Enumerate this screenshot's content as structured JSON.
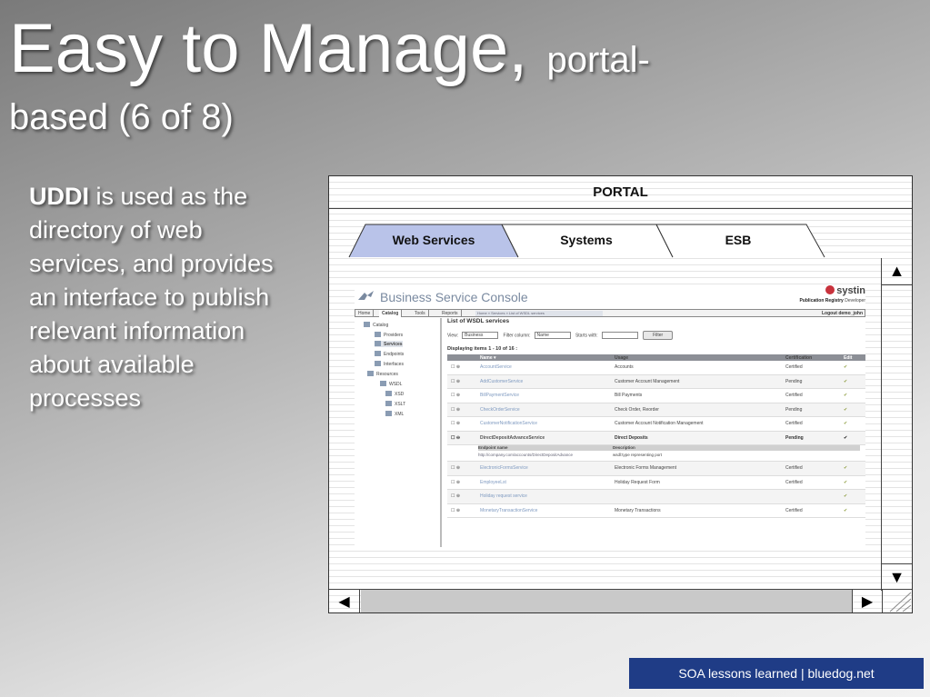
{
  "slide": {
    "title_main": "Easy to Manage,",
    "title_small": "portal-",
    "title_line2": "based (6 of 8)",
    "bullet_bold": "UDDI",
    "bullet_text": " is used as the directory of web services, and provides an interface to publish relevant information about available processes",
    "footer": "SOA lessons learned | bluedog.net"
  },
  "portal": {
    "title": "PORTAL",
    "tabs": [
      {
        "label": "Web Services",
        "active": true
      },
      {
        "label": "Systems",
        "active": false
      },
      {
        "label": "ESB",
        "active": false
      }
    ],
    "scroll": {
      "up_icon": "▲",
      "down_icon": "▼",
      "left_icon": "◀",
      "right_icon": "▶"
    }
  },
  "console": {
    "title": "Business Service Console",
    "brand": "systin",
    "registry_label": "Publication Registry",
    "registry_user": "Developer",
    "nav_tabs": [
      "Home",
      "Catalog",
      "Tools",
      "Reports"
    ],
    "breadcrumb": "Home » Services » List of WSDL services",
    "logout": "Logout demo_john",
    "tree": [
      "Catalog",
      "Providers",
      "Services",
      "Endpoints",
      "Interfaces",
      "Resources",
      "WSDL",
      "XSD",
      "XSLT",
      "XML"
    ],
    "list_title": "List of WSDL services",
    "view_label": "View:",
    "view_value": "Business",
    "filter_label": "Filter column:",
    "filter_value": "Name",
    "starts_label": "Starts with:",
    "filter_button": "Filter",
    "count_text": "Displaying items 1 - 10 of 16 :",
    "columns": {
      "name": "Name ▾",
      "desc": "Usage",
      "cert": "Certification",
      "edit": "Edit"
    },
    "rows": [
      {
        "name": "AccountService",
        "desc": "Accounts",
        "cert": "Certified"
      },
      {
        "name": "AddCustomerService",
        "desc": "Customer Account Management",
        "cert": "Pending"
      },
      {
        "name": "BillPaymentService",
        "desc": "Bill Payments",
        "cert": "Certified"
      },
      {
        "name": "CheckOrderService",
        "desc": "Check Order, Reorder",
        "cert": "Pending"
      },
      {
        "name": "CustomerNotificationService",
        "desc": "Customer Account Notification Management",
        "cert": "Certified"
      },
      {
        "name": "DirectDepositAdvanceService",
        "desc": "Direct Deposits",
        "cert": "Pending"
      },
      {
        "name": "ElectronicFormsService",
        "desc": "Electronic Forms Management",
        "cert": "Certified"
      },
      {
        "name": "EmployeeLst",
        "desc": "Holiday Request Form",
        "cert": "Certified"
      },
      {
        "name": "Holiday request service",
        "desc": "",
        "cert": ""
      },
      {
        "name": "MonetaryTransactionService",
        "desc": "Monetary Transactions",
        "cert": "Certified"
      }
    ],
    "detail": {
      "endpoint_label": "Endpoint name",
      "description_label": "Description",
      "endpoint_value": "http://company.com/accounts/DirectDepositAdvance",
      "description_value": "wsdl:type representing port"
    },
    "edit_icon": "✔"
  }
}
